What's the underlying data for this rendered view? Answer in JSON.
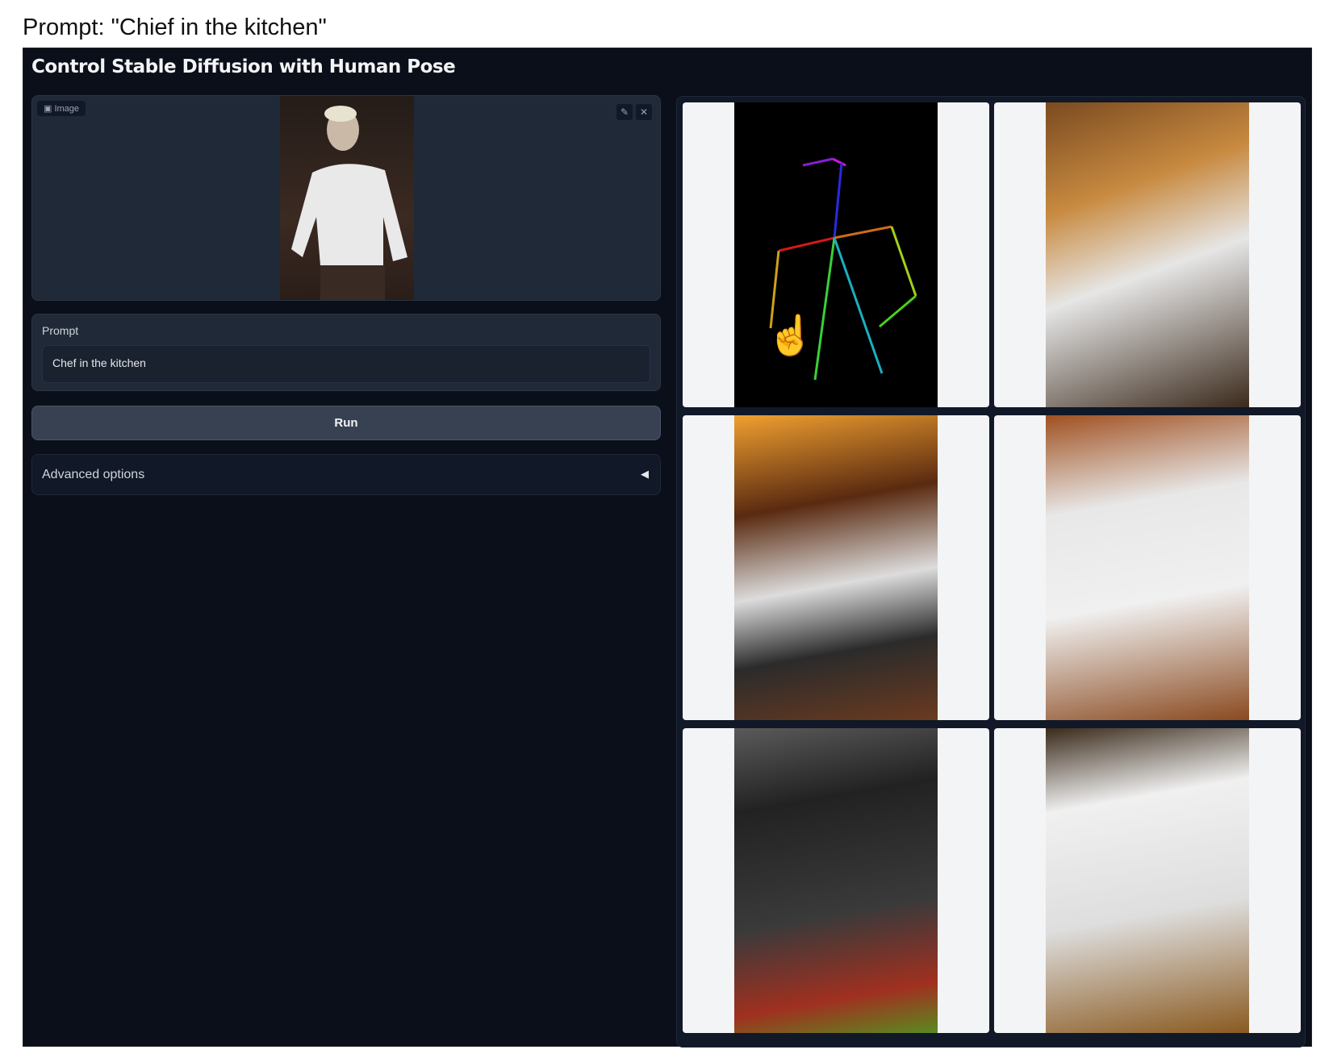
{
  "caption": "Prompt: \"Chief in the kitchen\"",
  "app": {
    "title": "Control Stable Diffusion with Human Pose"
  },
  "image_input": {
    "label": "Image",
    "edit_icon": "pencil-icon",
    "clear_icon": "close-icon"
  },
  "prompt": {
    "label": "Prompt",
    "value": "Chef in the kitchen"
  },
  "run_button": "Run",
  "advanced": {
    "label": "Advanced options"
  },
  "gallery": {
    "items": [
      "pose skeleton",
      "chef 1",
      "chef 2",
      "chef 3",
      "chef 4",
      "chef 5"
    ]
  }
}
